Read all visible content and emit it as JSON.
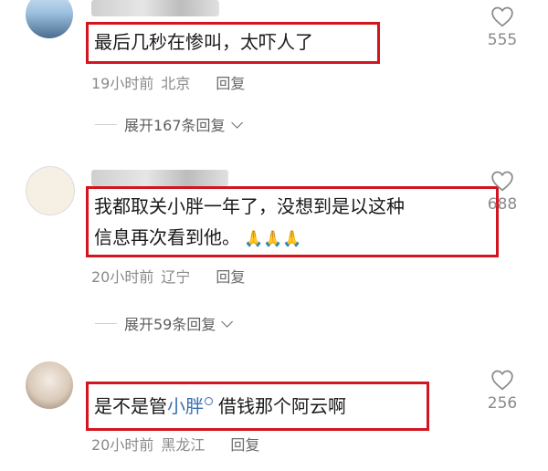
{
  "comments": [
    {
      "text": "最后几秒在惨叫，太吓人了",
      "time": "19小时前",
      "location": "北京",
      "reply_label": "回复",
      "expand_label": "展开167条回复",
      "likes": "555"
    },
    {
      "text_line1": "我都取关小胖一年了，没想到是以这种",
      "text_line2": "信息再次看到他。",
      "emoji": "🙏🙏🙏",
      "time": "20小时前",
      "location": "辽宁",
      "reply_label": "回复",
      "expand_label": "展开59条回复",
      "likes": "688"
    },
    {
      "text_before": "是不是管",
      "text_highlight": "小胖",
      "text_after": "借钱那个阿云啊",
      "time": "20小时前",
      "location": "黑龙江",
      "reply_label": "回复",
      "likes": "256"
    }
  ],
  "colors": {
    "highlight_border": "#d2151f",
    "link_blue": "#3a6fb0",
    "meta_gray": "#8a8a8a"
  },
  "icons": {
    "like": "heart-outline-icon",
    "expand": "chevron-down-icon",
    "search": "search-mini-icon"
  }
}
